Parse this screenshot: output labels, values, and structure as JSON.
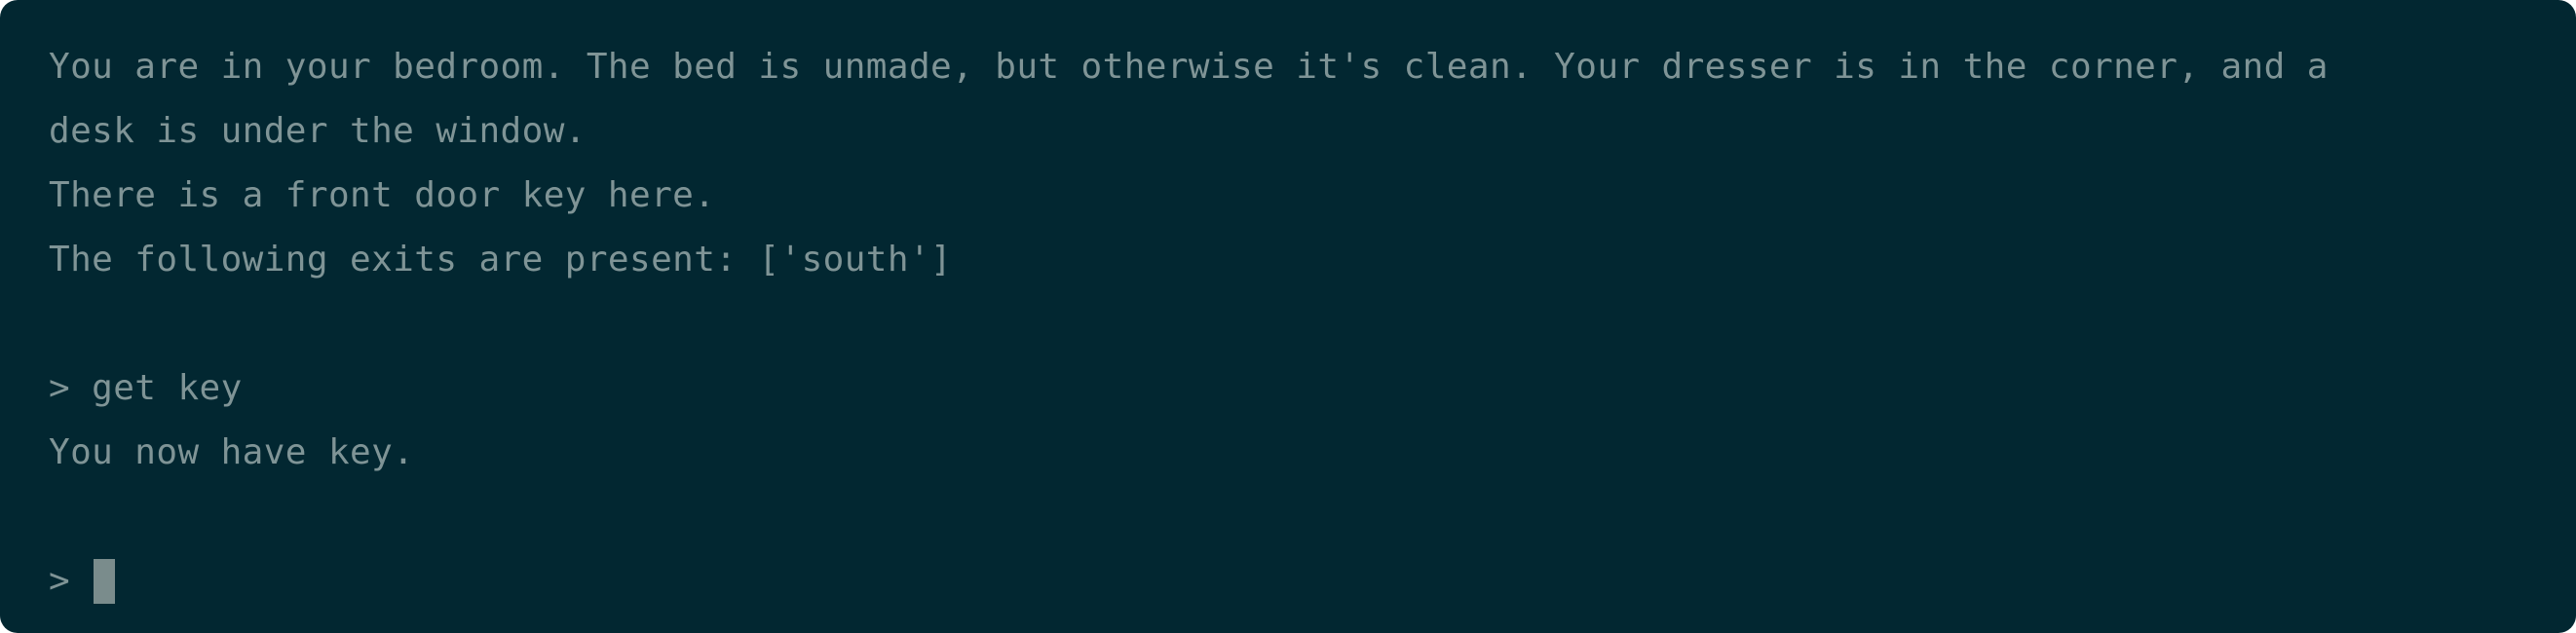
{
  "terminal": {
    "lines": [
      "You are in your bedroom. The bed is unmade, but otherwise it's clean. Your dresser is in the corner, and a",
      "desk is under the window.",
      "There is a front door key here.",
      "The following exits are present: ['south']"
    ],
    "command": "> get key",
    "response": "You now have key.",
    "prompt_symbol": ">"
  },
  "colors": {
    "background": "#022731",
    "text": "#7f9496",
    "cursor": "#7a8c8c"
  }
}
